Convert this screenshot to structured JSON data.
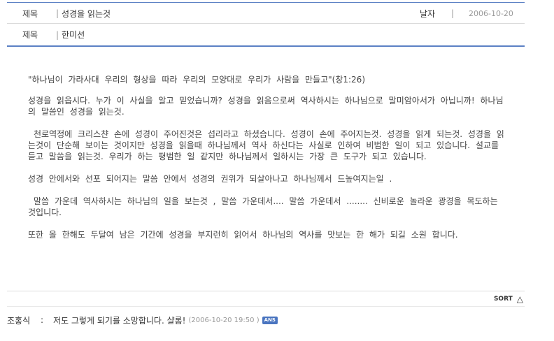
{
  "header": {
    "subject_label": "제목",
    "subject_sep": "|",
    "subject_value": "성경을 읽는것",
    "date_label": "날자",
    "date_sep": "|",
    "date_value": "2006-10-20",
    "author_label": "제목",
    "author_sep": "|",
    "author_value": "한미선"
  },
  "article": {
    "paragraphs": [
      "\"하나님이 가라사대 우리의 형상을 따라 우리의 모양대로 우리가 사람을 만들고\"(창1:26)",
      "성경을 읽읍시다. 누가 이 사실을 알고 믿었습니까? 성경을 읽음으로써 역사하시는 하나님으로 말미암아서가 아닙니까! 하나님의 말씀인 성경을 읽는것.",
      "천로역정에 크리스챤 손에 성경이 주어진것은 섭리라고 하셨습니다. 성경이 손에 주어지는것. 성경을 읽게 되는것. 성경을 읽는것이 단순해 보이는 것이지만 성경을 읽을때 하나님께서 역사 하신다는 사실로 인하여 비범한 일이 되고 있습니다. 설교를 듣고 말씀을 읽는것. 우리가 하는 평범한 일 같지만 하나님께서 일하시는 가장 큰 도구가 되고 있습니다.",
      "성경 안에서와 선포 되어지는 말씀 안에서 성경의 권위가 되살아나고 하나님께서 드높여지는일 .",
      "말씀 가운데 역사하시는 하나님의 일을 보는것 , 말씀 가운데서.... 말씀 가운데서 ........ 신비로운 놀라운 광경을 목도하는 것입니다.",
      "또한 올 한해도 두달여 남은 기간에 성경을 부지런히 읽어서 하나님의 역사를 맛보는 한 해가 되길 소원 합니다."
    ]
  },
  "sort": {
    "label": "SORT",
    "icon": "triangle-up-icon"
  },
  "comments": [
    {
      "author": "조홍식",
      "colon": ":",
      "text": "저도 그렇게 되기를 소망합니다. 샬롬!",
      "date": "(2006-10-20 19:50",
      "date_close": ")",
      "reply_label": "ANS"
    }
  ],
  "colors": {
    "accent_rule": "#5b80c4",
    "reply_button": "#4a75c0",
    "muted_text": "#999999"
  }
}
